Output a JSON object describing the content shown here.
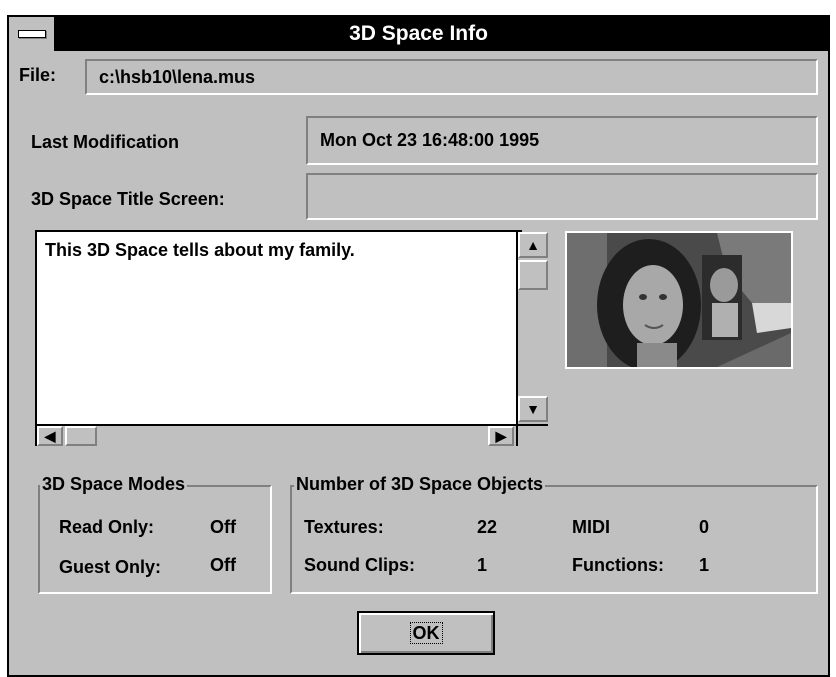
{
  "window": {
    "title": "3D Space Info"
  },
  "file": {
    "label": "File:",
    "value": "c:\\hsb10\\lena.mus"
  },
  "last_modification": {
    "label": "Last Modification",
    "value": "Mon Oct 23 16:48:00 1995"
  },
  "title_screen": {
    "label": "3D Space Title Screen:",
    "value": ""
  },
  "description": {
    "text": "This 3D Space tells about my family."
  },
  "modes": {
    "legend": "3D Space Modes",
    "read_only_label": "Read Only:",
    "read_only_value": "Off",
    "guest_only_label": "Guest Only:",
    "guest_only_value": "Off"
  },
  "objects": {
    "legend": "Number of 3D Space Objects",
    "textures_label": "Textures:",
    "textures_value": "22",
    "midi_label": "MIDI",
    "midi_value": "0",
    "sound_clips_label": "Sound Clips:",
    "sound_clips_value": "1",
    "functions_label": "Functions:",
    "functions_value": "1"
  },
  "ok_button": {
    "label": "OK"
  },
  "icons": {
    "scroll_up": "▲",
    "scroll_down": "▼",
    "scroll_left": "◀",
    "scroll_right": "▶"
  },
  "colors": {
    "dialog_bg": "#c0c0c0",
    "titlebar_bg": "#000000"
  }
}
